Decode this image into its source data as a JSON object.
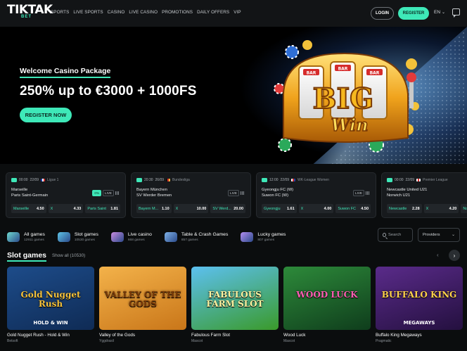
{
  "header": {
    "logo_top": "TIKTAK",
    "logo_bottom": "BET",
    "nav": [
      "SPORTS",
      "LIVE SPORTS",
      "CASINO",
      "LIVE CASINO",
      "PROMOTIONS",
      "DAILY OFFERS",
      "VIP"
    ],
    "login_label": "LOGIN",
    "register_label": "REGISTER",
    "language": "EN"
  },
  "hero": {
    "subtitle": "Welcome Casino Package",
    "title": "250% up to €3000 + 1000FS",
    "cta": "REGISTER NOW",
    "art_text_big": "BIG",
    "art_text_win": "Win",
    "art_reel_label": "BAR"
  },
  "matches": [
    {
      "time": "00:00",
      "date": "22/09",
      "league": "Ligue 1",
      "team1": "Marseille",
      "team2": "Paris Saint-Germain",
      "badges": [
        "0%",
        "LIVE"
      ],
      "odds": [
        {
          "label": "Marseille",
          "value": "4.50"
        },
        {
          "label": "X",
          "value": "4.33"
        },
        {
          "label": "Paris Saint",
          "value": "1.81"
        }
      ]
    },
    {
      "time": "20:30",
      "date": "26/09",
      "league": "Bundesliga",
      "team1": "Bayern München",
      "team2": "SV Werder Bremen",
      "badges": [
        "LIVE"
      ],
      "odds": [
        {
          "label": "Bayern M...",
          "value": "1.10"
        },
        {
          "label": "X",
          "value": "10.00"
        },
        {
          "label": "SV Werd...",
          "value": "20.00"
        }
      ]
    },
    {
      "time": "12:00",
      "date": "22/09",
      "league": "WK-League Women",
      "team1": "Gyeongju FC (W)",
      "team2": "Suwon FC (W)",
      "badges": [
        "LIVE"
      ],
      "odds": [
        {
          "label": "Gyeongju",
          "value": "1.61"
        },
        {
          "label": "X",
          "value": "4.00"
        },
        {
          "label": "Suwon FC",
          "value": "4.50"
        }
      ]
    },
    {
      "time": "00:00",
      "date": "22/09",
      "league": "Premier League",
      "team1": "Newcastle United U21",
      "team2": "Norwich U21",
      "badges": [
        "LIVE"
      ],
      "odds": [
        {
          "label": "Newcastle",
          "value": "2.28"
        },
        {
          "label": "X",
          "value": "4.20"
        },
        {
          "label": "Norwich",
          "value": "2.40"
        }
      ]
    }
  ],
  "categories": [
    {
      "title": "All games",
      "sub": "12911 games",
      "color": "#6fd9d0"
    },
    {
      "title": "Slot games",
      "sub": "10530 games",
      "color": "#5fc4e6"
    },
    {
      "title": "Live casino",
      "sub": "668 games",
      "color": "#c98be0"
    },
    {
      "title": "Table & Crash Games",
      "sub": "857 games",
      "color": "#7fb2e8"
    },
    {
      "title": "Lucky games",
      "sub": "807 games",
      "color": "#b38ef0"
    }
  ],
  "search": {
    "placeholder": "Search"
  },
  "providers_label": "Providers",
  "slot_section": {
    "title": "Slot games",
    "show_all": "Show all (10530)"
  },
  "games": [
    {
      "name": "Gold Nugget Rush - Hold & Win",
      "provider": "Betsoft",
      "art": "Gold Nugget Rush",
      "art_sub": "HOLD & WIN",
      "bg1": "#1d4c8a",
      "bg2": "#0f2b55",
      "fg": "#f6c23a"
    },
    {
      "name": "Valley of the Gods",
      "provider": "Yggdrasil",
      "art": "VALLEY OF THE GODS",
      "art_sub": "",
      "bg1": "#f3b24a",
      "bg2": "#c97619",
      "fg": "#7a3a08"
    },
    {
      "name": "Fabulous Farm Slot",
      "provider": "Mascot",
      "art": "FABULOUS FARM SLOT",
      "art_sub": "",
      "bg1": "#5cc0f0",
      "bg2": "#3a9a2a",
      "fg": "#fff2a0"
    },
    {
      "name": "Wood Luck",
      "provider": "Mascot",
      "art": "WOOD LUCK",
      "art_sub": "",
      "bg1": "#2d8a3a",
      "bg2": "#0f3d1c",
      "fg": "#ff5db3"
    },
    {
      "name": "Buffalo King Megaways",
      "provider": "Pragmatic",
      "art": "BUFFALO KING",
      "art_sub": "MEGAWAYS",
      "bg1": "#5a2b8a",
      "bg2": "#24103f",
      "fg": "#ffd24a"
    }
  ]
}
